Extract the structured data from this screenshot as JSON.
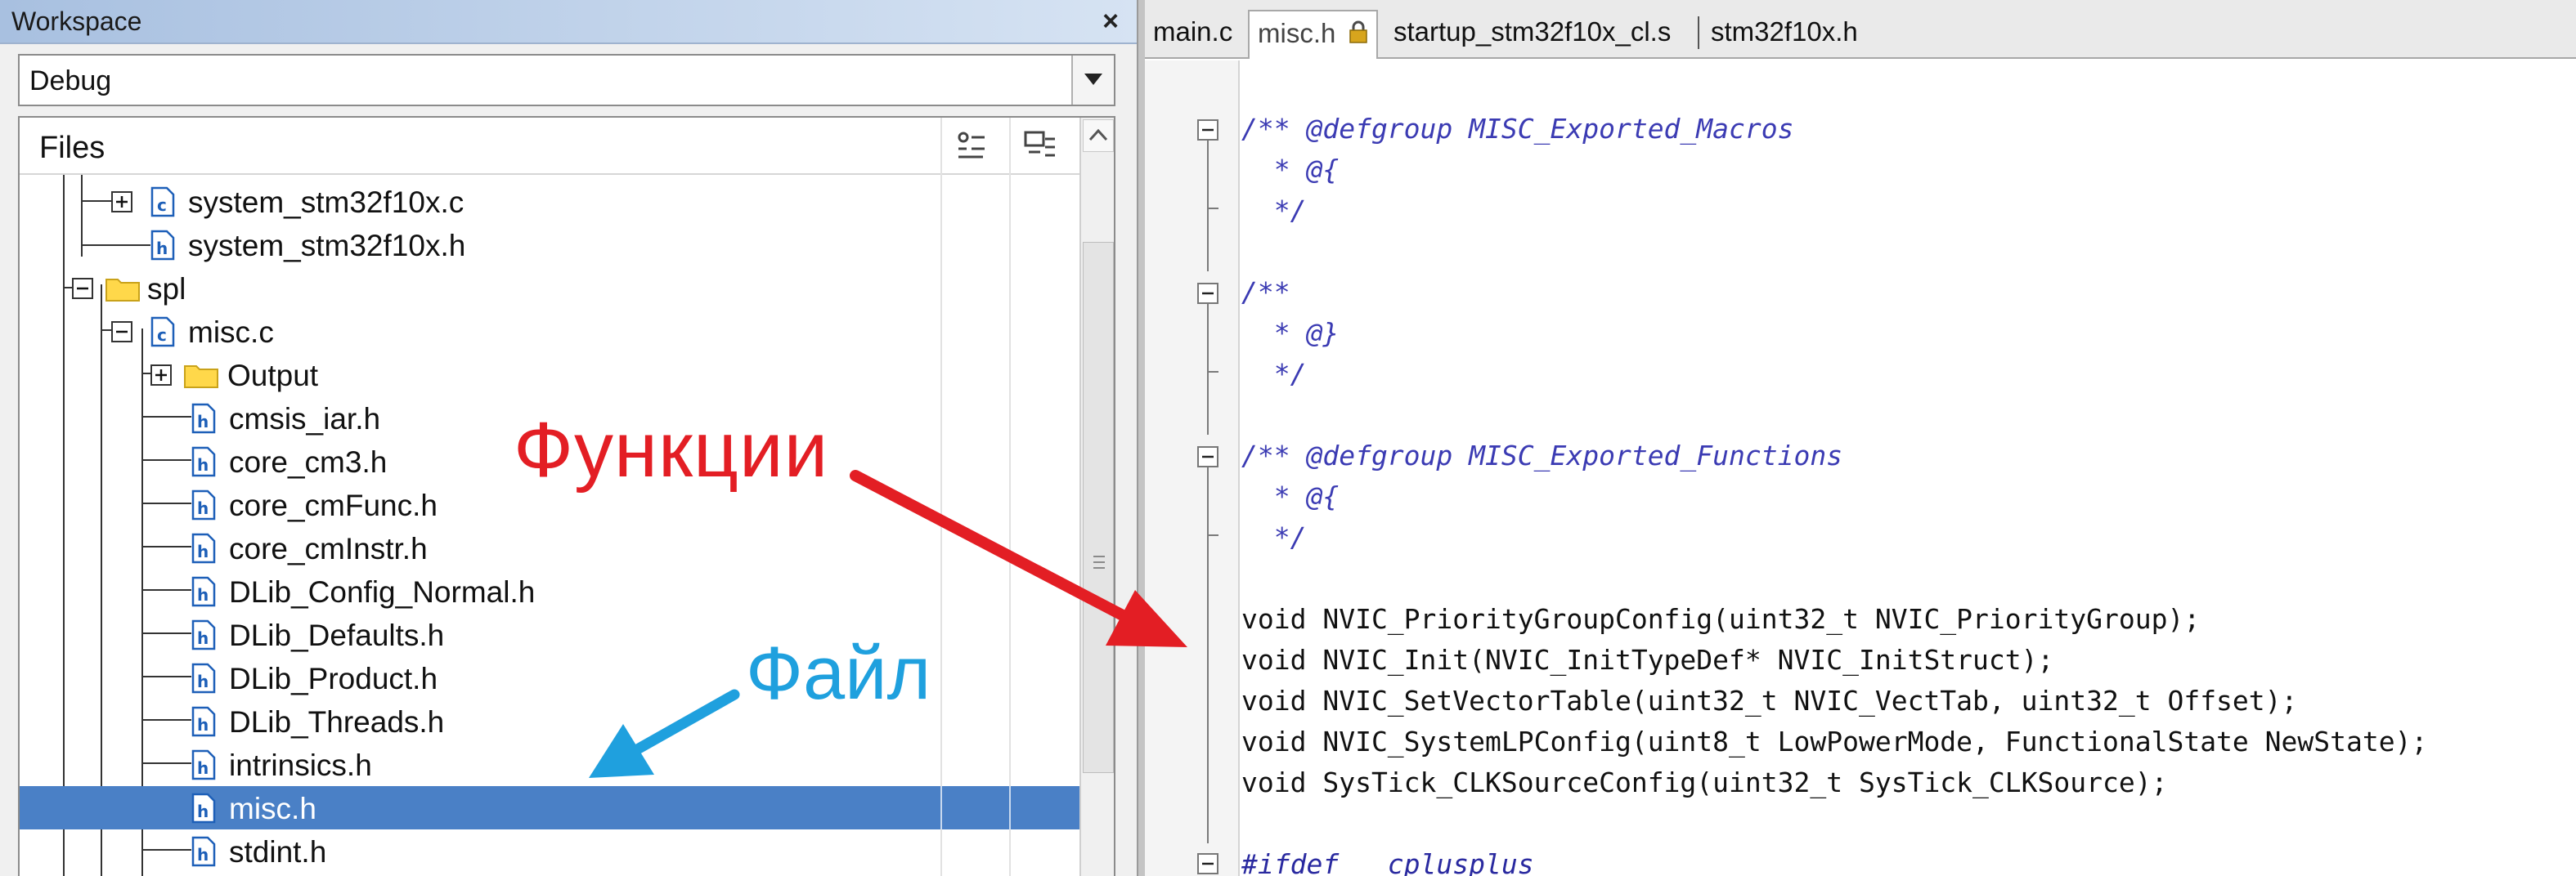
{
  "workspace": {
    "title": "Workspace",
    "close_glyph": "×",
    "configuration": "Debug",
    "files_header": "Files",
    "tree": [
      {
        "label": "system_stm32f10x.c",
        "icon": "c-file-icon"
      },
      {
        "label": "system_stm32f10x.h",
        "icon": "h-file-icon"
      },
      {
        "label": "spl",
        "icon": "folder-icon"
      },
      {
        "label": "misc.c",
        "icon": "c-file-icon"
      },
      {
        "label": "Output",
        "icon": "folder-icon"
      },
      {
        "label": "cmsis_iar.h",
        "icon": "h-file-icon"
      },
      {
        "label": "core_cm3.h",
        "icon": "h-file-icon"
      },
      {
        "label": "core_cmFunc.h",
        "icon": "h-file-icon"
      },
      {
        "label": "core_cmInstr.h",
        "icon": "h-file-icon"
      },
      {
        "label": "DLib_Config_Normal.h",
        "icon": "h-file-icon"
      },
      {
        "label": "DLib_Defaults.h",
        "icon": "h-file-icon"
      },
      {
        "label": "DLib_Product.h",
        "icon": "h-file-icon"
      },
      {
        "label": "DLib_Threads.h",
        "icon": "h-file-icon"
      },
      {
        "label": "intrinsics.h",
        "icon": "h-file-icon"
      },
      {
        "label": "misc.h",
        "icon": "h-file-icon"
      },
      {
        "label": "stdint.h",
        "icon": "h-file-icon"
      }
    ],
    "selected_file": "misc.h"
  },
  "editor": {
    "tabs": [
      {
        "label": "main.c"
      },
      {
        "label": "misc.h"
      },
      {
        "label": "startup_stm32f10x_cl.s"
      },
      {
        "label": "stm32f10x.h"
      }
    ],
    "active_tab": "misc.h",
    "code": [
      "/** @defgroup MISC_Exported_Macros",
      "  * @{",
      "  */",
      "",
      "/**",
      "  * @}",
      "  */",
      "",
      "/** @defgroup MISC_Exported_Functions",
      "  * @{",
      "  */",
      "",
      "void NVIC_PriorityGroupConfig(uint32_t NVIC_PriorityGroup);",
      "void NVIC_Init(NVIC_InitTypeDef* NVIC_InitStruct);",
      "void NVIC_SetVectorTable(uint32_t NVIC_VectTab, uint32_t Offset);",
      "void NVIC_SystemLPConfig(uint8_t LowPowerMode, FunctionalState NewState);",
      "void SysTick_CLKSourceConfig(uint32_t SysTick_CLKSource);",
      "",
      "#ifdef __cplusplus"
    ]
  },
  "annotations": {
    "functions_label": "Функции",
    "file_label": "Файл",
    "functions_color": "#e31e24",
    "file_color": "#1fa0de"
  },
  "colors": {
    "selection": "#4a80c6",
    "comment": "#3b3bb3"
  }
}
